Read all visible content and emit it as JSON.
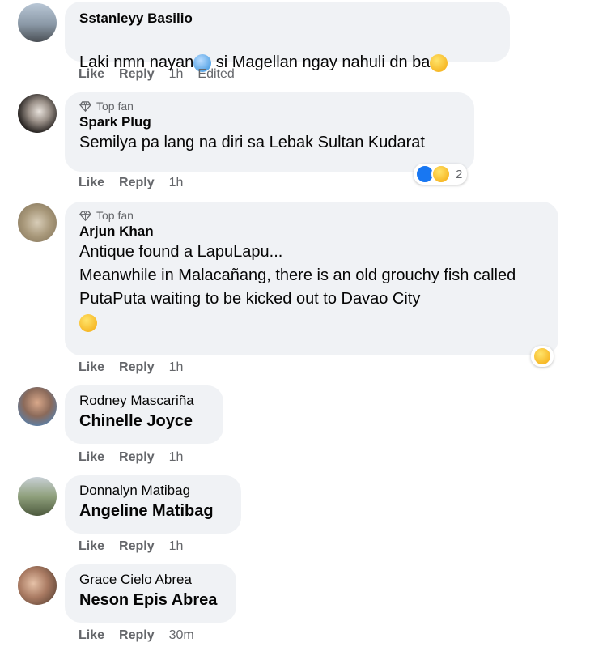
{
  "comments": [
    {
      "author": "Sstanleyy Basilio",
      "text_a": "Laki nmn nayan",
      "text_b": " si Magellan ngay nahuli dn ba",
      "actions": {
        "like": "Like",
        "reply": "Reply",
        "time": "1h",
        "edited": "Edited"
      }
    },
    {
      "badge": "Top fan",
      "author": "Spark Plug",
      "text": "Semilya pa lang na diri sa Lebak Sultan Kudarat",
      "reaction_count": "2",
      "actions": {
        "like": "Like",
        "reply": "Reply",
        "time": "1h"
      }
    },
    {
      "badge": "Top fan",
      "author": "Arjun Khan",
      "text": "Antique found a LapuLapu...\nMeanwhile in Malacañang, there is an old grouchy fish called PutaPuta waiting to be kicked out to Davao City",
      "actions": {
        "like": "Like",
        "reply": "Reply",
        "time": "1h"
      }
    },
    {
      "author": "Rodney Mascariña",
      "mention": "Chinelle Joyce",
      "actions": {
        "like": "Like",
        "reply": "Reply",
        "time": "1h"
      }
    },
    {
      "author": "Donnalyn Matibag",
      "mention": "Angeline Matibag",
      "actions": {
        "like": "Like",
        "reply": "Reply",
        "time": "1h"
      }
    },
    {
      "author": "Grace Cielo Abrea",
      "mention": "Neson Epis Abrea",
      "actions": {
        "like": "Like",
        "reply": "Reply",
        "time": "30m"
      }
    }
  ],
  "icons": {
    "top_fan": "diamond-icon",
    "reactions": [
      "like-icon",
      "haha-icon"
    ]
  }
}
